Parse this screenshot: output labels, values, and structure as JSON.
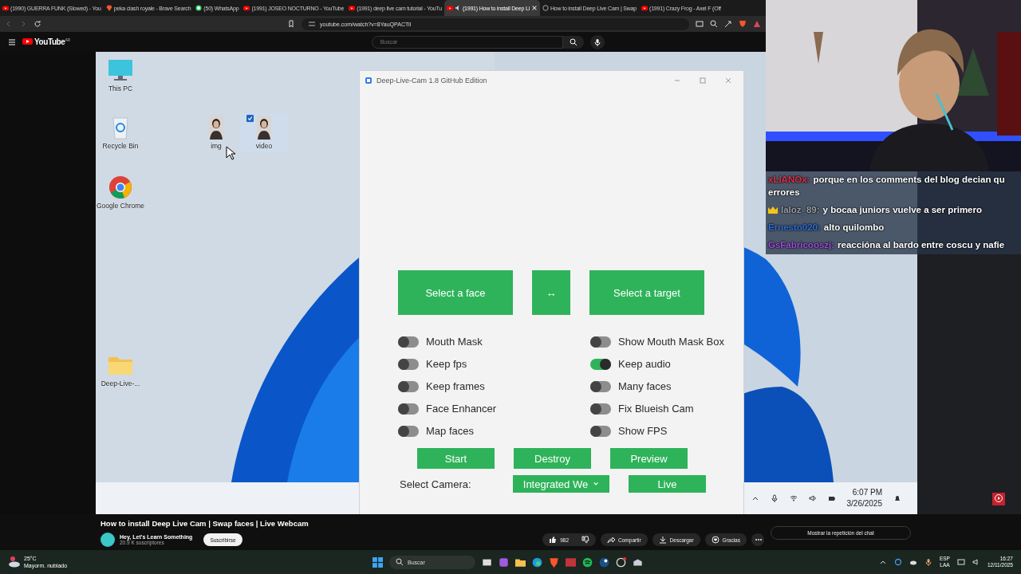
{
  "browser": {
    "tabs": [
      {
        "title": "(1990) GUERRA FUNK (Slowed) - You",
        "kind": "youtube",
        "audio": false,
        "selected": false
      },
      {
        "title": "peka clash royale - Brave Search",
        "kind": "brave",
        "audio": false,
        "selected": false
      },
      {
        "title": "(50) WhatsApp",
        "kind": "whatsapp",
        "audio": false,
        "selected": false
      },
      {
        "title": "(1991) JOSEO NOCTURNO - YouTube",
        "kind": "youtube",
        "audio": false,
        "selected": false
      },
      {
        "title": "(1991) deep live cam tutorial - YouTu",
        "kind": "youtube",
        "audio": false,
        "selected": false
      },
      {
        "title": "(1991) How to install Deep Li",
        "kind": "youtube",
        "audio": true,
        "selected": true
      },
      {
        "title": "How to install Deep Live Cam | Swap",
        "kind": "globe",
        "audio": false,
        "selected": false
      },
      {
        "title": "(1991) Crazy Frog - Axel F (Off",
        "kind": "youtube",
        "audio": false,
        "selected": false
      }
    ],
    "url": "youtube.com/watch?v=8YauQPACTiI"
  },
  "youtube_header": {
    "logo": "YouTube",
    "region": "AR",
    "search_placeholder": "Buscar"
  },
  "desktop": {
    "icons": [
      {
        "label": "This PC",
        "kind": "pc",
        "selected": false
      },
      {
        "label": "Recycle Bin",
        "kind": "bin",
        "selected": false
      },
      {
        "label": "img",
        "selected": false
      },
      {
        "label": "video",
        "selected": true
      },
      {
        "label": "Google Chrome",
        "kind": "chrome",
        "selected": false
      },
      {
        "label": "Deep-Live-...",
        "kind": "folder",
        "selected": false
      }
    ],
    "tray": {
      "time": "6:07 PM",
      "date": "3/26/2025"
    }
  },
  "app_window": {
    "title": "Deep-Live-Cam 1.8 GitHub Edition",
    "source_button": "Select a face",
    "swap_button": "↔",
    "target_button": "Select a target",
    "left_options": [
      {
        "label": "Mouth Mask",
        "on": false
      },
      {
        "label": "Keep fps",
        "on": false
      },
      {
        "label": "Keep frames",
        "on": false
      },
      {
        "label": "Face Enhancer",
        "on": false
      },
      {
        "label": "Map faces",
        "on": false
      }
    ],
    "right_options": [
      {
        "label": "Show Mouth Mask Box",
        "on": false
      },
      {
        "label": "Keep audio",
        "on": true
      },
      {
        "label": "Many faces",
        "on": false
      },
      {
        "label": "Fix Blueish Cam",
        "on": false
      },
      {
        "label": "Show FPS",
        "on": false
      }
    ],
    "actions": [
      "Start",
      "Destroy",
      "Preview"
    ],
    "camera_label": "Select Camera:",
    "camera_value": "Integrated We",
    "live_button": "Live"
  },
  "chat": [
    {
      "user": "xLIANOx:",
      "color": "#e0304a",
      "badge": false,
      "lines": [
        "porque en los comments del blog decian qu",
        "errores"
      ]
    },
    {
      "user": "laloz_89:",
      "color": "#9aa0a8",
      "badge": true,
      "lines": [
        "y bocaa juniors vuelve a ser primero"
      ]
    },
    {
      "user": "Ernesto020:",
      "color": "#2f6fd6",
      "badge": false,
      "lines": [
        "alto quilombo"
      ]
    },
    {
      "user": "GsFabricooszj:",
      "color": "#a04ce0",
      "badge": false,
      "lines": [
        "reaccióna al bardo entre coscu y nafie"
      ]
    }
  ],
  "video_info": {
    "title": "How to install Deep Live Cam | Swap faces | Live Webcam",
    "channel": "Hey, Let's Learn Something",
    "subscribers": "20.9 K suscriptores",
    "subscribe": "Suscribirse",
    "likes": "982",
    "actions": [
      {
        "label": "Compartir",
        "kind": "share"
      },
      {
        "label": "Descargar",
        "kind": "download"
      },
      {
        "label": "Gracias",
        "kind": "thanks"
      }
    ],
    "chat_replay": "Mostrar la repetición del chat"
  },
  "taskbar": {
    "weather_temp": "25°C",
    "weather_text": "Mayorm. nublado",
    "search_placeholder": "Buscar",
    "language": "ESP",
    "layout": "LAA",
    "time": "16:27",
    "date": "12/11/2025"
  }
}
